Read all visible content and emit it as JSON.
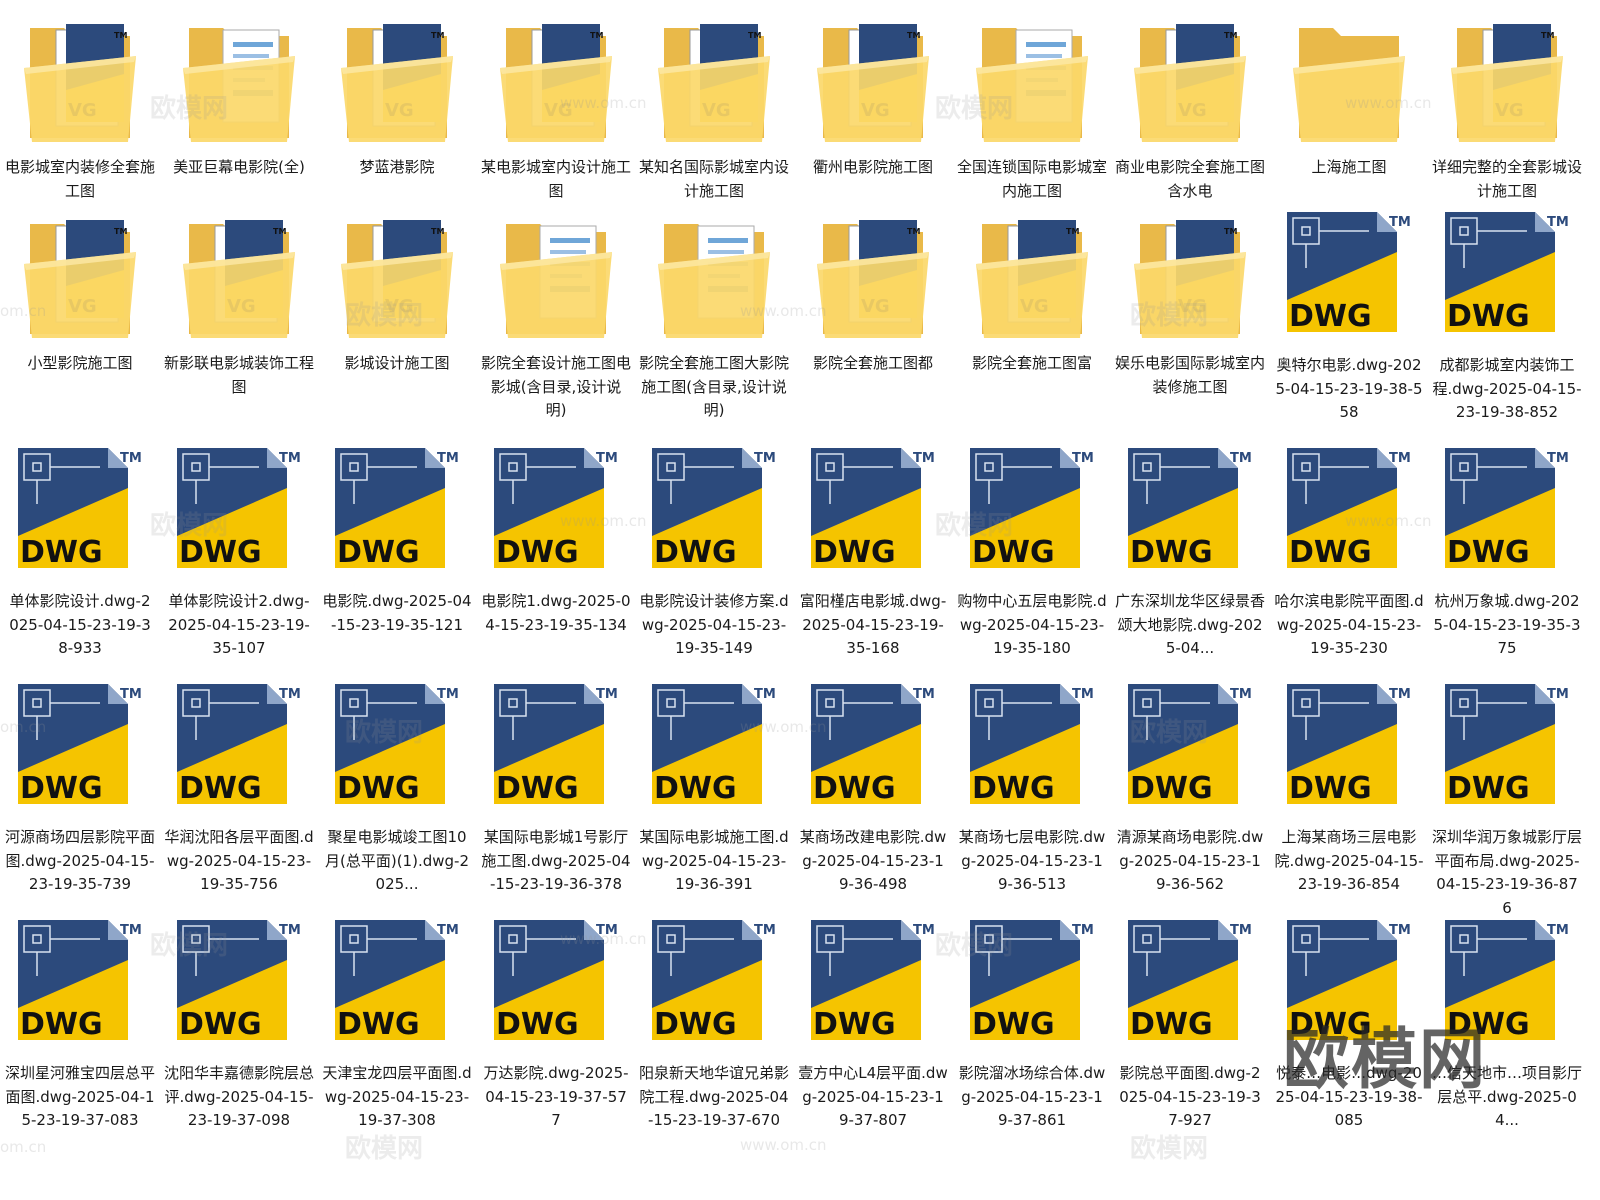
{
  "watermarks": {
    "text": "欧模网",
    "url": "www.om.cn",
    "corner_url": "om.cn"
  },
  "brand_logo": "欧模网",
  "colors": {
    "folder_back": "#e9b949",
    "folder_front": "#fbd86a",
    "dwg_blue": "#2c4a7c",
    "dwg_yellow": "#f5c400",
    "text": "#1a1a1a"
  },
  "rows": [
    [
      {
        "type": "folder",
        "icon": "folder-dwg-icon",
        "label": "电影城室内装修全套施工图"
      },
      {
        "type": "folder",
        "icon": "folder-docs-icon",
        "label": "美亚巨幕电影院(全)"
      },
      {
        "type": "folder",
        "icon": "folder-dwg-icon",
        "label": "梦蓝港影院"
      },
      {
        "type": "folder",
        "icon": "folder-dwg-icon",
        "label": "某电影城室内设计施工图"
      },
      {
        "type": "folder",
        "icon": "folder-dwg-icon",
        "label": "某知名国际影城室内设计施工图"
      },
      {
        "type": "folder",
        "icon": "folder-dwg-icon",
        "label": "衢州电影院施工图"
      },
      {
        "type": "folder",
        "icon": "folder-docs-icon",
        "label": "全国连锁国际电影城室内施工图"
      },
      {
        "type": "folder",
        "icon": "folder-dwg-icon",
        "label": "商业电影院全套施工图含水电"
      },
      {
        "type": "folder",
        "icon": "folder-empty-icon",
        "label": "上海施工图"
      },
      {
        "type": "folder",
        "icon": "folder-dwg-icon",
        "label": "详细完整的全套影城设计施工图"
      }
    ],
    [
      {
        "type": "folder",
        "icon": "folder-dwg-icon",
        "label": "小型影院施工图"
      },
      {
        "type": "folder",
        "icon": "folder-dwg-icon",
        "label": "新影联电影城装饰工程图"
      },
      {
        "type": "folder",
        "icon": "folder-dwg-icon",
        "label": "影城设计施工图"
      },
      {
        "type": "folder",
        "icon": "folder-docs-icon",
        "label": "影院全套设计施工图电影城(含目录,设计说明)"
      },
      {
        "type": "folder",
        "icon": "folder-docs-icon",
        "label": "影院全套施工图大影院施工图(含目录,设计说明)"
      },
      {
        "type": "folder",
        "icon": "folder-dwg-icon",
        "label": "影院全套施工图都"
      },
      {
        "type": "folder",
        "icon": "folder-dwg-icon",
        "label": "影院全套施工图富"
      },
      {
        "type": "folder",
        "icon": "folder-dwg-icon",
        "label": "娱乐电影国际影城室内装修施工图"
      },
      {
        "type": "dwg",
        "icon": "dwg-file-icon",
        "label": "奥特尔电影.dwg-2025-04-15-23-19-38-558"
      },
      {
        "type": "dwg",
        "icon": "dwg-file-icon",
        "label": "成都影城室内装饰工程.dwg-2025-04-15-23-19-38-852"
      }
    ],
    [
      {
        "type": "dwg",
        "icon": "dwg-file-icon",
        "label": "单体影院设计.dwg-2025-04-15-23-19-38-933"
      },
      {
        "type": "dwg",
        "icon": "dwg-file-icon",
        "label": "单体影院设计2.dwg-2025-04-15-23-19-35-107"
      },
      {
        "type": "dwg",
        "icon": "dwg-file-icon",
        "label": "电影院.dwg-2025-04-15-23-19-35-121"
      },
      {
        "type": "dwg",
        "icon": "dwg-file-icon",
        "label": "电影院1.dwg-2025-04-15-23-19-35-134"
      },
      {
        "type": "dwg",
        "icon": "dwg-file-icon",
        "label": "电影院设计装修方案.dwg-2025-04-15-23-19-35-149"
      },
      {
        "type": "dwg",
        "icon": "dwg-file-icon",
        "label": "富阳槿店电影城.dwg-2025-04-15-23-19-35-168"
      },
      {
        "type": "dwg",
        "icon": "dwg-file-icon",
        "label": "购物中心五层电影院.dwg-2025-04-15-23-19-35-180"
      },
      {
        "type": "dwg",
        "icon": "dwg-file-icon",
        "label": "广东深圳龙华区绿景香颂大地影院.dwg-2025-04..."
      },
      {
        "type": "dwg",
        "icon": "dwg-file-icon",
        "label": "哈尔滨电影院平面图.dwg-2025-04-15-23-19-35-230"
      },
      {
        "type": "dwg",
        "icon": "dwg-file-icon",
        "label": "杭州万象城.dwg-2025-04-15-23-19-35-375"
      }
    ],
    [
      {
        "type": "dwg",
        "icon": "dwg-file-icon",
        "label": "河源商场四层影院平面图.dwg-2025-04-15-23-19-35-739"
      },
      {
        "type": "dwg",
        "icon": "dwg-file-icon",
        "label": "华润沈阳各层平面图.dwg-2025-04-15-23-19-35-756"
      },
      {
        "type": "dwg",
        "icon": "dwg-file-icon",
        "label": "聚星电影城竣工图10月(总平面)(1).dwg-2025..."
      },
      {
        "type": "dwg",
        "icon": "dwg-file-icon",
        "label": "某国际电影城1号影厅施工图.dwg-2025-04-15-23-19-36-378"
      },
      {
        "type": "dwg",
        "icon": "dwg-file-icon",
        "label": "某国际电影城施工图.dwg-2025-04-15-23-19-36-391"
      },
      {
        "type": "dwg",
        "icon": "dwg-file-icon",
        "label": "某商场改建电影院.dwg-2025-04-15-23-19-36-498"
      },
      {
        "type": "dwg",
        "icon": "dwg-file-icon",
        "label": "某商场七层电影院.dwg-2025-04-15-23-19-36-513"
      },
      {
        "type": "dwg",
        "icon": "dwg-file-icon",
        "label": "清源某商场电影院.dwg-2025-04-15-23-19-36-562"
      },
      {
        "type": "dwg",
        "icon": "dwg-file-icon",
        "label": "上海某商场三层电影院.dwg-2025-04-15-23-19-36-854"
      },
      {
        "type": "dwg",
        "icon": "dwg-file-icon",
        "label": "深圳华润万象城影厅层平面布局.dwg-2025-04-15-23-19-36-876"
      }
    ],
    [
      {
        "type": "dwg",
        "icon": "dwg-file-icon",
        "label": "深圳星河雅宝四层总平面图.dwg-2025-04-15-23-19-37-083"
      },
      {
        "type": "dwg",
        "icon": "dwg-file-icon",
        "label": "沈阳华丰嘉德影院层总评.dwg-2025-04-15-23-19-37-098"
      },
      {
        "type": "dwg",
        "icon": "dwg-file-icon",
        "label": "天津宝龙四层平面图.dwg-2025-04-15-23-19-37-308"
      },
      {
        "type": "dwg",
        "icon": "dwg-file-icon",
        "label": "万达影院.dwg-2025-04-15-23-19-37-577"
      },
      {
        "type": "dwg",
        "icon": "dwg-file-icon",
        "label": "阳泉新天地华谊兄弟影院工程.dwg-2025-04-15-23-19-37-670"
      },
      {
        "type": "dwg",
        "icon": "dwg-file-icon",
        "label": "壹方中心L4层平面.dwg-2025-04-15-23-19-37-807"
      },
      {
        "type": "dwg",
        "icon": "dwg-file-icon",
        "label": "影院溜冰场综合体.dwg-2025-04-15-23-19-37-861"
      },
      {
        "type": "dwg",
        "icon": "dwg-file-icon",
        "label": "影院总平面图.dwg-2025-04-15-23-19-37-927"
      },
      {
        "type": "dwg",
        "icon": "dwg-file-icon",
        "label": "悦泰…电影…dwg-2025-04-15-23-19-38-085"
      },
      {
        "type": "dwg",
        "icon": "dwg-file-icon",
        "label": "…信天地市…项目影厅层总平.dwg-2025-04..."
      }
    ]
  ]
}
